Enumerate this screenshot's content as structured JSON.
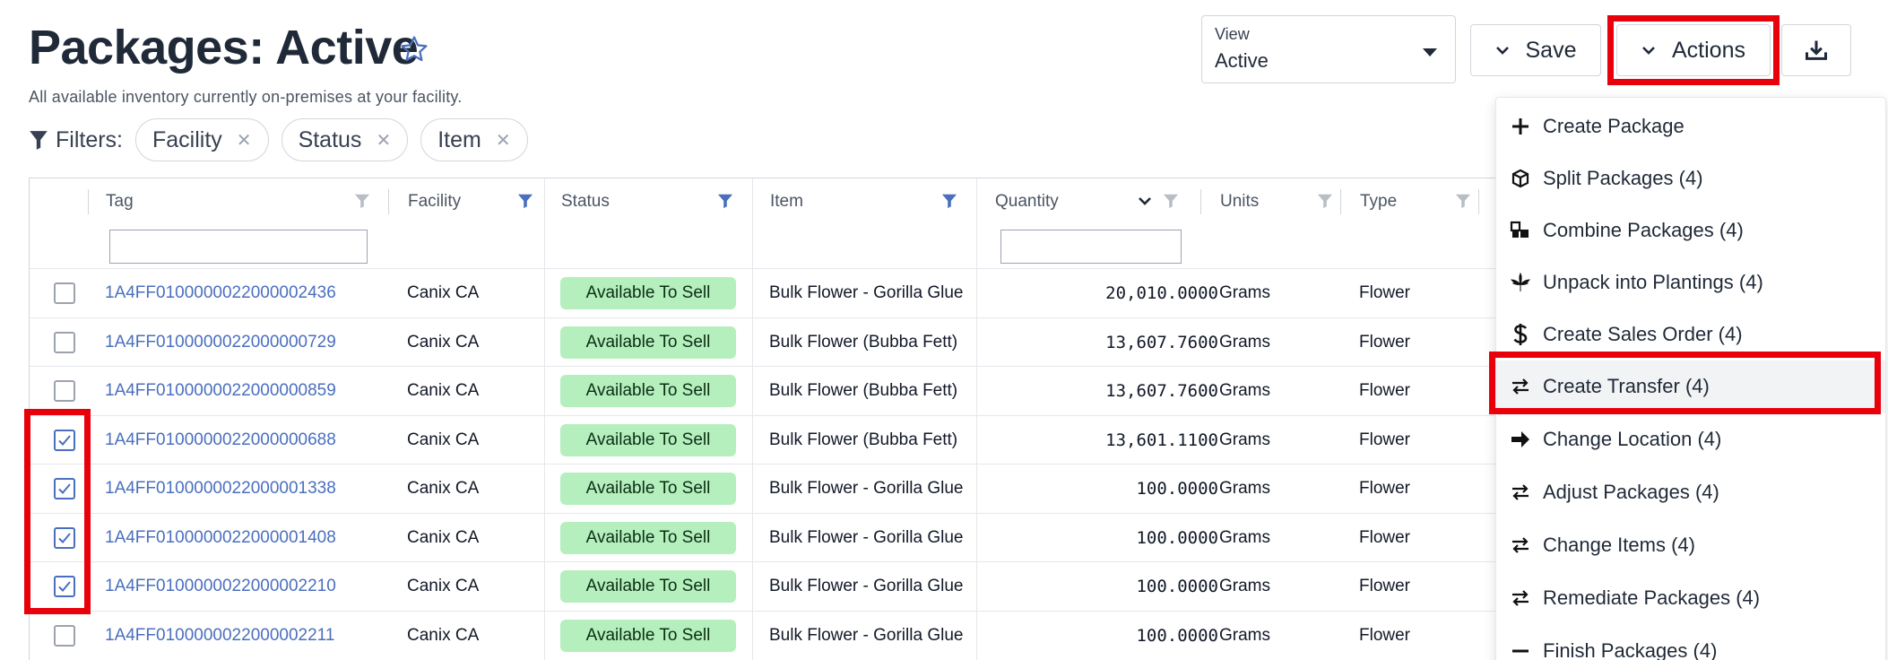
{
  "page": {
    "title": "Packages: Active",
    "subtitle": "All available inventory currently on-premises at your facility."
  },
  "filters": {
    "label": "Filters:",
    "chips": [
      "Facility",
      "Status",
      "Item"
    ]
  },
  "view": {
    "label": "View",
    "value": "Active"
  },
  "toolbar": {
    "save_label": "Save",
    "actions_label": "Actions"
  },
  "columns": [
    "Tag",
    "Facility",
    "Status",
    "Item",
    "Quantity",
    "Units",
    "Type"
  ],
  "rows": [
    {
      "checked": false,
      "tag": "1A4FF0100000022000002436",
      "facility": "Canix CA",
      "status": "Available To Sell",
      "item": "Bulk Flower - Gorilla Glue",
      "quantity": "20,010.0000",
      "units": "Grams",
      "type": "Flower"
    },
    {
      "checked": false,
      "tag": "1A4FF0100000022000000729",
      "facility": "Canix CA",
      "status": "Available To Sell",
      "item": "Bulk Flower (Bubba Fett)",
      "quantity": "13,607.7600",
      "units": "Grams",
      "type": "Flower"
    },
    {
      "checked": false,
      "tag": "1A4FF0100000022000000859",
      "facility": "Canix CA",
      "status": "Available To Sell",
      "item": "Bulk Flower (Bubba Fett)",
      "quantity": "13,607.7600",
      "units": "Grams",
      "type": "Flower"
    },
    {
      "checked": true,
      "tag": "1A4FF0100000022000000688",
      "facility": "Canix CA",
      "status": "Available To Sell",
      "item": "Bulk Flower (Bubba Fett)",
      "quantity": "13,601.1100",
      "units": "Grams",
      "type": "Flower"
    },
    {
      "checked": true,
      "tag": "1A4FF0100000022000001338",
      "facility": "Canix CA",
      "status": "Available To Sell",
      "item": "Bulk Flower - Gorilla Glue",
      "quantity": "100.0000",
      "units": "Grams",
      "type": "Flower"
    },
    {
      "checked": true,
      "tag": "1A4FF0100000022000001408",
      "facility": "Canix CA",
      "status": "Available To Sell",
      "item": "Bulk Flower - Gorilla Glue",
      "quantity": "100.0000",
      "units": "Grams",
      "type": "Flower"
    },
    {
      "checked": true,
      "tag": "1A4FF0100000022000002210",
      "facility": "Canix CA",
      "status": "Available To Sell",
      "item": "Bulk Flower - Gorilla Glue",
      "quantity": "100.0000",
      "units": "Grams",
      "type": "Flower"
    },
    {
      "checked": false,
      "tag": "1A4FF0100000022000002211",
      "facility": "Canix CA",
      "status": "Available To Sell",
      "item": "Bulk Flower - Gorilla Glue",
      "quantity": "100.0000",
      "units": "Grams",
      "type": "Flower"
    }
  ],
  "actions_menu": [
    {
      "label": "Create Package",
      "icon": "plus-icon"
    },
    {
      "label": "Split Packages (4)",
      "icon": "box-icon"
    },
    {
      "label": "Combine Packages (4)",
      "icon": "boxes-icon"
    },
    {
      "label": "Unpack into Plantings (4)",
      "icon": "cannabis-leaf-icon"
    },
    {
      "label": "Create Sales Order (4)",
      "icon": "dollar-icon"
    },
    {
      "label": "Create Transfer (4)",
      "icon": "exchange-icon"
    },
    {
      "label": "Change Location (4)",
      "icon": "arrow-right-icon"
    },
    {
      "label": "Adjust Packages (4)",
      "icon": "exchange-icon"
    },
    {
      "label": "Change Items (4)",
      "icon": "exchange-icon"
    },
    {
      "label": "Remediate Packages (4)",
      "icon": "exchange-icon"
    },
    {
      "label": "Finish Packages (4)",
      "icon": "minus-icon"
    }
  ],
  "colors": {
    "link": "#4a6fbf",
    "status_badge": "#b4efbd",
    "highlight": "#e8000b",
    "filter_active": "#4a6fbf",
    "filter_inactive": "#b8bec6"
  }
}
